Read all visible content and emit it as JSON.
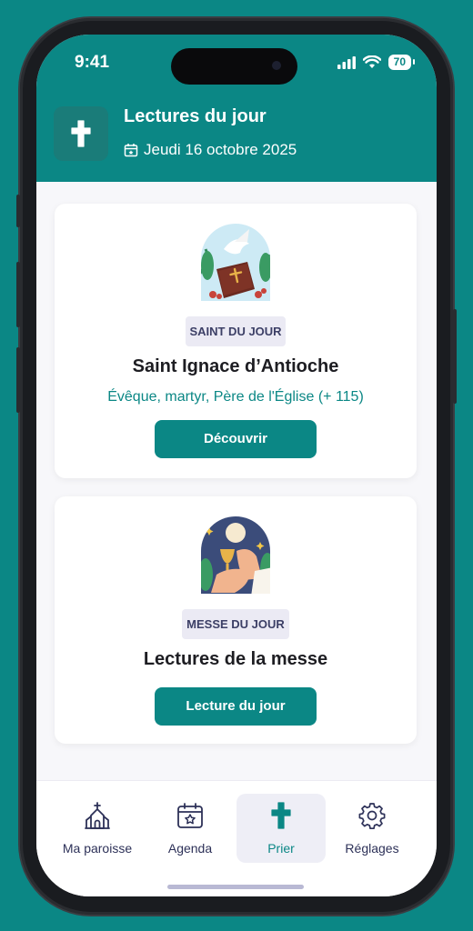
{
  "status": {
    "time": "9:41",
    "battery": "70"
  },
  "header": {
    "title": "Lectures du jour",
    "date": "Jeudi 16 octobre 2025",
    "icon": "cross-icon"
  },
  "cards": [
    {
      "badge": "SAINT DU JOUR",
      "title": "Saint Ignace d’Antioche",
      "subtitle": "Évêque, martyr, Père de l'Église (+ 115)",
      "button": "Découvrir"
    },
    {
      "badge": "MESSE DU JOUR",
      "title": "Lectures de la messe",
      "button": "Lecture du jour"
    }
  ],
  "tabs": [
    {
      "label": "Ma paroisse",
      "icon": "church-icon"
    },
    {
      "label": "Agenda",
      "icon": "calendar-icon"
    },
    {
      "label": "Prier",
      "icon": "cross-icon",
      "active": true
    },
    {
      "label": "Réglages",
      "icon": "gear-icon"
    }
  ],
  "colors": {
    "primary": "#0b8785",
    "badge_bg": "#ebeaf4",
    "badge_text": "#3c3f66",
    "nav_text": "#2d3158"
  }
}
